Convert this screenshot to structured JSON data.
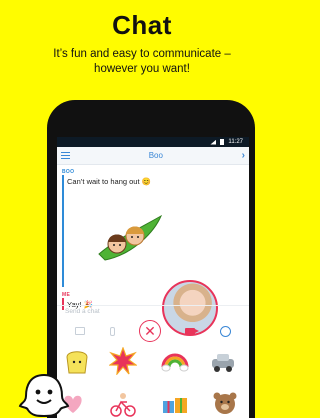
{
  "promo": {
    "title": "Chat",
    "subtitle_line1": "It’s fun and easy to communicate –",
    "subtitle_line2": "however you want!"
  },
  "status_bar": {
    "time": "11:27"
  },
  "chat_header": {
    "title": "Boo"
  },
  "messages": [
    {
      "sender": "BOO",
      "text": "Can’t wait to hang out 😊"
    },
    {
      "sender": "ME",
      "text": "Yay! 🎉"
    }
  ],
  "composer": {
    "placeholder": "Send a chat"
  },
  "toolbar": {
    "icons": [
      "photo-icon",
      "phone-icon",
      "snap-close-icon",
      "video-icon",
      "emoji-icon"
    ],
    "snap_glyph": "✕"
  },
  "stickers": [
    "bread-sticker",
    "explosion-sticker",
    "rainbow-sticker",
    "car-sticker",
    "hearts-sticker",
    "bicycle-sticker",
    "gifts-sticker",
    "bear-sticker"
  ],
  "colors": {
    "background": "#fffc00",
    "accent_blue": "#3a87d6",
    "accent_red": "#e8345a"
  }
}
